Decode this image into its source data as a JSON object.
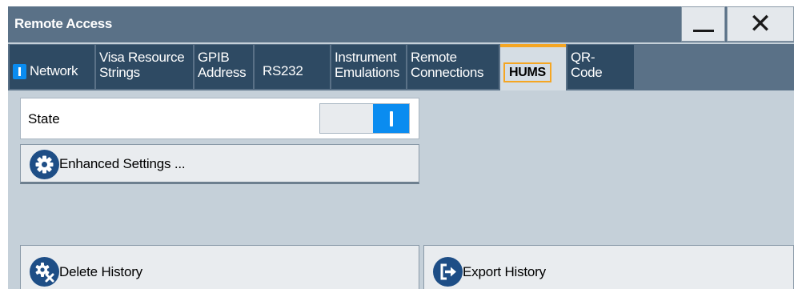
{
  "window": {
    "title": "Remote Access",
    "minimize_icon": "minimize-icon",
    "close_glyph": "✕"
  },
  "tabs": [
    {
      "line1": "Network",
      "line2": "",
      "indicator": "on"
    },
    {
      "line1": "Visa Resource",
      "line2": "Strings"
    },
    {
      "line1": "GPIB",
      "line2": "Address"
    },
    {
      "line1": "RS232",
      "line2": ""
    },
    {
      "line1": "Instrument",
      "line2": "Emulations"
    },
    {
      "line1": "Remote",
      "line2": "Connections"
    },
    {
      "line1": "HUMS",
      "line2": "",
      "active": true
    },
    {
      "line1": "QR-",
      "line2": "Code"
    }
  ],
  "state": {
    "label": "State",
    "value": "on"
  },
  "buttons": {
    "enhanced": {
      "label": "Enhanced Settings ...",
      "icon": "gear-icon"
    },
    "delete": {
      "label": "Delete History",
      "icon": "delete-history-icon"
    },
    "export": {
      "label": "Export History",
      "icon": "export-icon"
    }
  },
  "colors": {
    "accent_blue": "#0a8cf0",
    "active_tab_highlight": "#f5a623",
    "title_bar": "#5a7187",
    "tab_bg": "#2e4a63"
  }
}
